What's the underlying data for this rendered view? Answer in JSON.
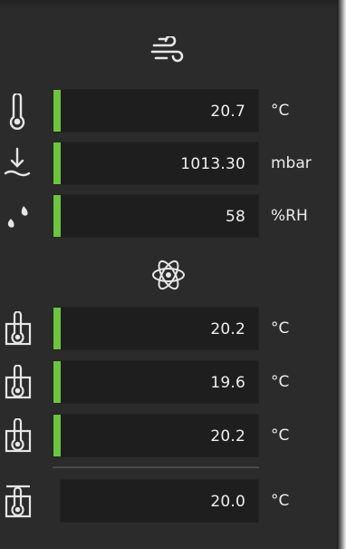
{
  "colors": {
    "accent_bar": "#6cc53c",
    "panel_bg": "#2b2b2b",
    "field_bg": "#1e1e1e"
  },
  "sections": [
    {
      "icon": "wind-icon"
    },
    {
      "icon": "atom-icon"
    }
  ],
  "environment": [
    {
      "icon": "thermometer-icon",
      "value": "20.7",
      "unit": "°C"
    },
    {
      "icon": "pressure-icon",
      "value": "1013.30",
      "unit": "mbar"
    },
    {
      "icon": "humidity-icon",
      "value": "58",
      "unit": "%RH"
    }
  ],
  "sensors": [
    {
      "icon": "probe-thermometer-icon",
      "value": "20.2",
      "unit": "°C"
    },
    {
      "icon": "probe-thermometer-icon",
      "value": "19.6",
      "unit": "°C"
    },
    {
      "icon": "probe-thermometer-icon",
      "value": "20.2",
      "unit": "°C"
    }
  ],
  "average": {
    "icon": "average-thermometer-icon",
    "value": "20.0",
    "unit": "°C"
  }
}
